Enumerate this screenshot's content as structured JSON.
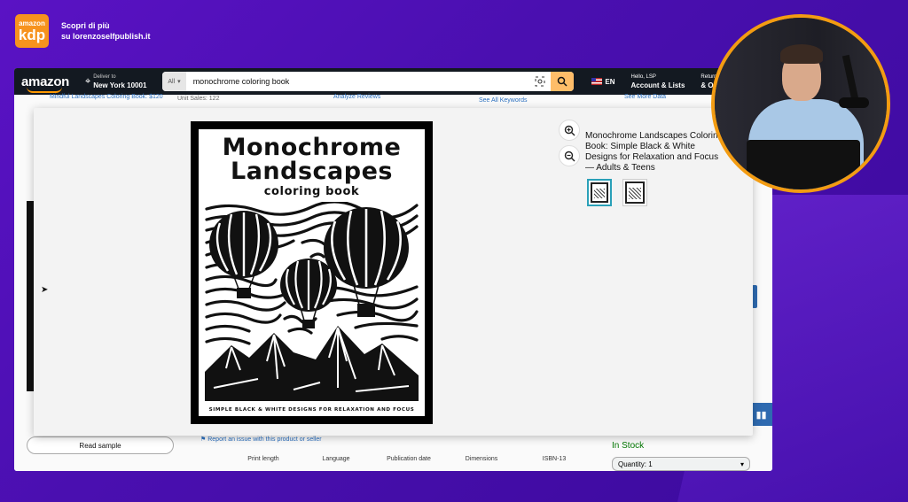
{
  "brand": {
    "logo_top": "amazon",
    "logo_main": "kdp",
    "line1": "Scopri di più",
    "line2": "su lorenzoselfpublish.it"
  },
  "header": {
    "logo": "amazon",
    "deliver_label": "Deliver to",
    "deliver_city": "New York 10001",
    "search_category": "All",
    "search_value": "monochrome coloring book",
    "lang": "EN",
    "hello": "Hello, LSP",
    "account": "Account & Lists",
    "returns": "Returns",
    "orders": "& Orders"
  },
  "background_page": {
    "faded1": "Mindful Landscapes Coloring Book: $120",
    "unit_sales": "Unit Sales:  122",
    "analyze_reviews": "Analyze Reviews",
    "see_keywords": "See All Keywords",
    "see_more": "See More Data",
    "read_sample": "Read sample",
    "report": "Report an issue with this product or seller",
    "details": [
      "Print length",
      "Language",
      "Publication date",
      "Dimensions",
      "ISBN-13"
    ],
    "in_stock": "In Stock",
    "quantity": "Quantity: 1"
  },
  "modal": {
    "cover_title_line1": "Monochrome",
    "cover_title_line2": "Landscapes",
    "cover_subtitle": "coloring book",
    "cover_tagline": "SIMPLE BLACK & WHITE DESIGNS FOR RELAXATION AND FOCUS",
    "product_title": "Monochrome Landscapes Coloring Book: Simple Black & White Designs for Relaxation and Focus — Adults & Teens"
  }
}
